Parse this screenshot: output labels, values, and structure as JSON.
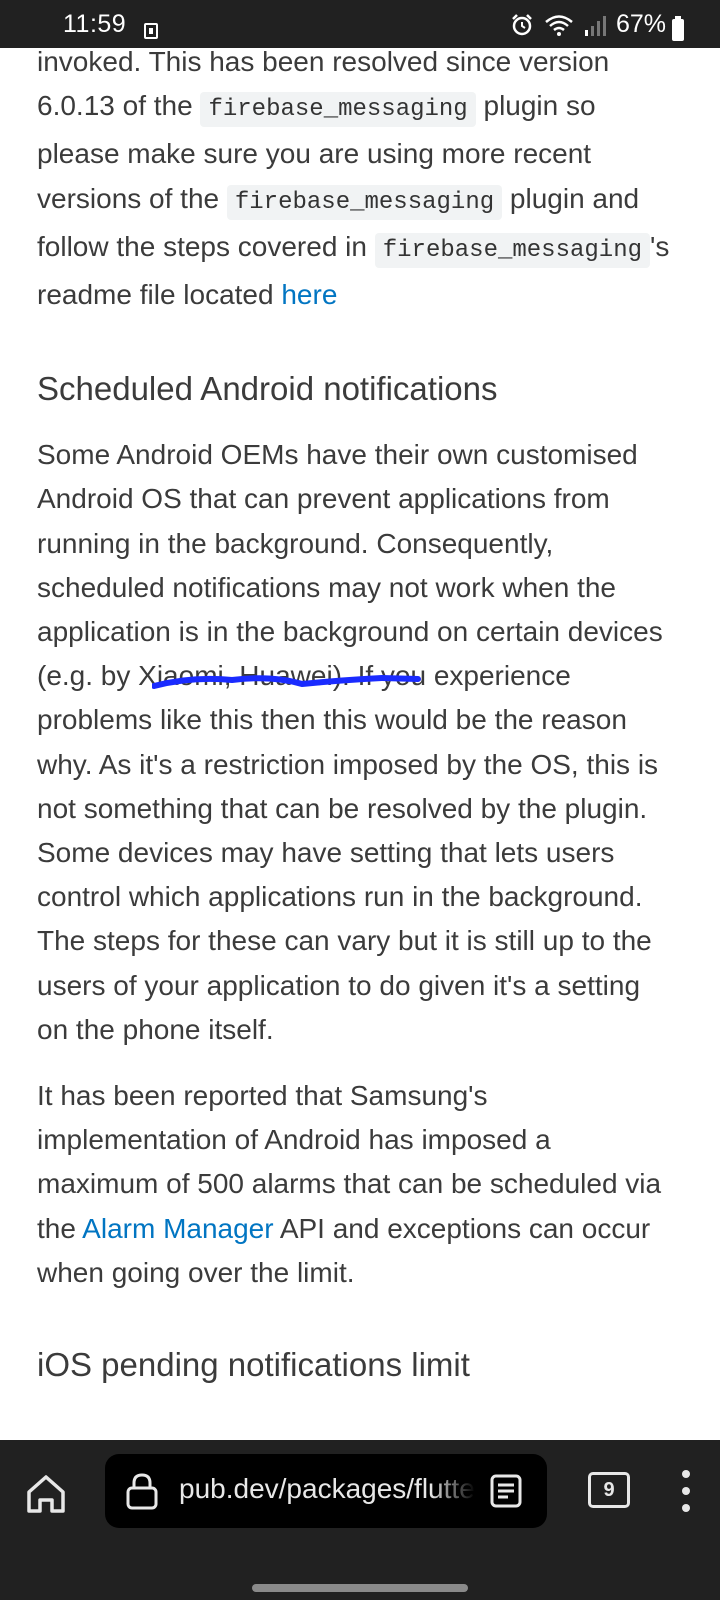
{
  "status_bar": {
    "time": "11:59",
    "battery": "67%",
    "icons": [
      "notification-icon",
      "alarm-icon",
      "wifi-icon",
      "signal-icon",
      "battery-icon"
    ]
  },
  "article": {
    "p1": {
      "t1": "invoked. This has been resolved since version 6.0.13 of the ",
      "code1": "firebase_messaging",
      "t2": " plugin so please make sure you are using more recent versions of the ",
      "code2": "firebase_messaging",
      "t3": " plugin and follow the steps covered in ",
      "code3": "firebase_messaging",
      "t4": "'s readme file located ",
      "link": "here"
    },
    "heading_scheduled": "Scheduled Android notifications",
    "p2": {
      "t1": "Some Android OEMs have their own customised Android OS that can prevent applications from running in the background. Consequently, scheduled notifications may not work when the application is in the background on certain devices (",
      "highlight": "e.g. by Xiaomi, Huawei",
      "t2": "). If you experience problems like this then this would be the reason why. As it's a restriction imposed by the OS, this is not something that can be resolved by the plugin. Some devices may have setting that lets users control which applications run in the background. The steps for these can vary but it is still up to the users of your application to do given it's a setting on the phone itself."
    },
    "p3": {
      "t1": "It has been reported that Samsung's implementation of Android has imposed a maximum of 500 alarms that can be scheduled via the ",
      "link": "Alarm Manager",
      "t2": " API and exceptions can occur when going over the limit."
    },
    "heading_ios": "iOS pending notifications limit"
  },
  "browser_bar": {
    "url": "pub.dev/packages/flutter_local_notifications",
    "tab_count": "9"
  },
  "colors": {
    "link": "#0175c2",
    "annotation": "#1a2bff",
    "bar_bg": "#212121"
  }
}
